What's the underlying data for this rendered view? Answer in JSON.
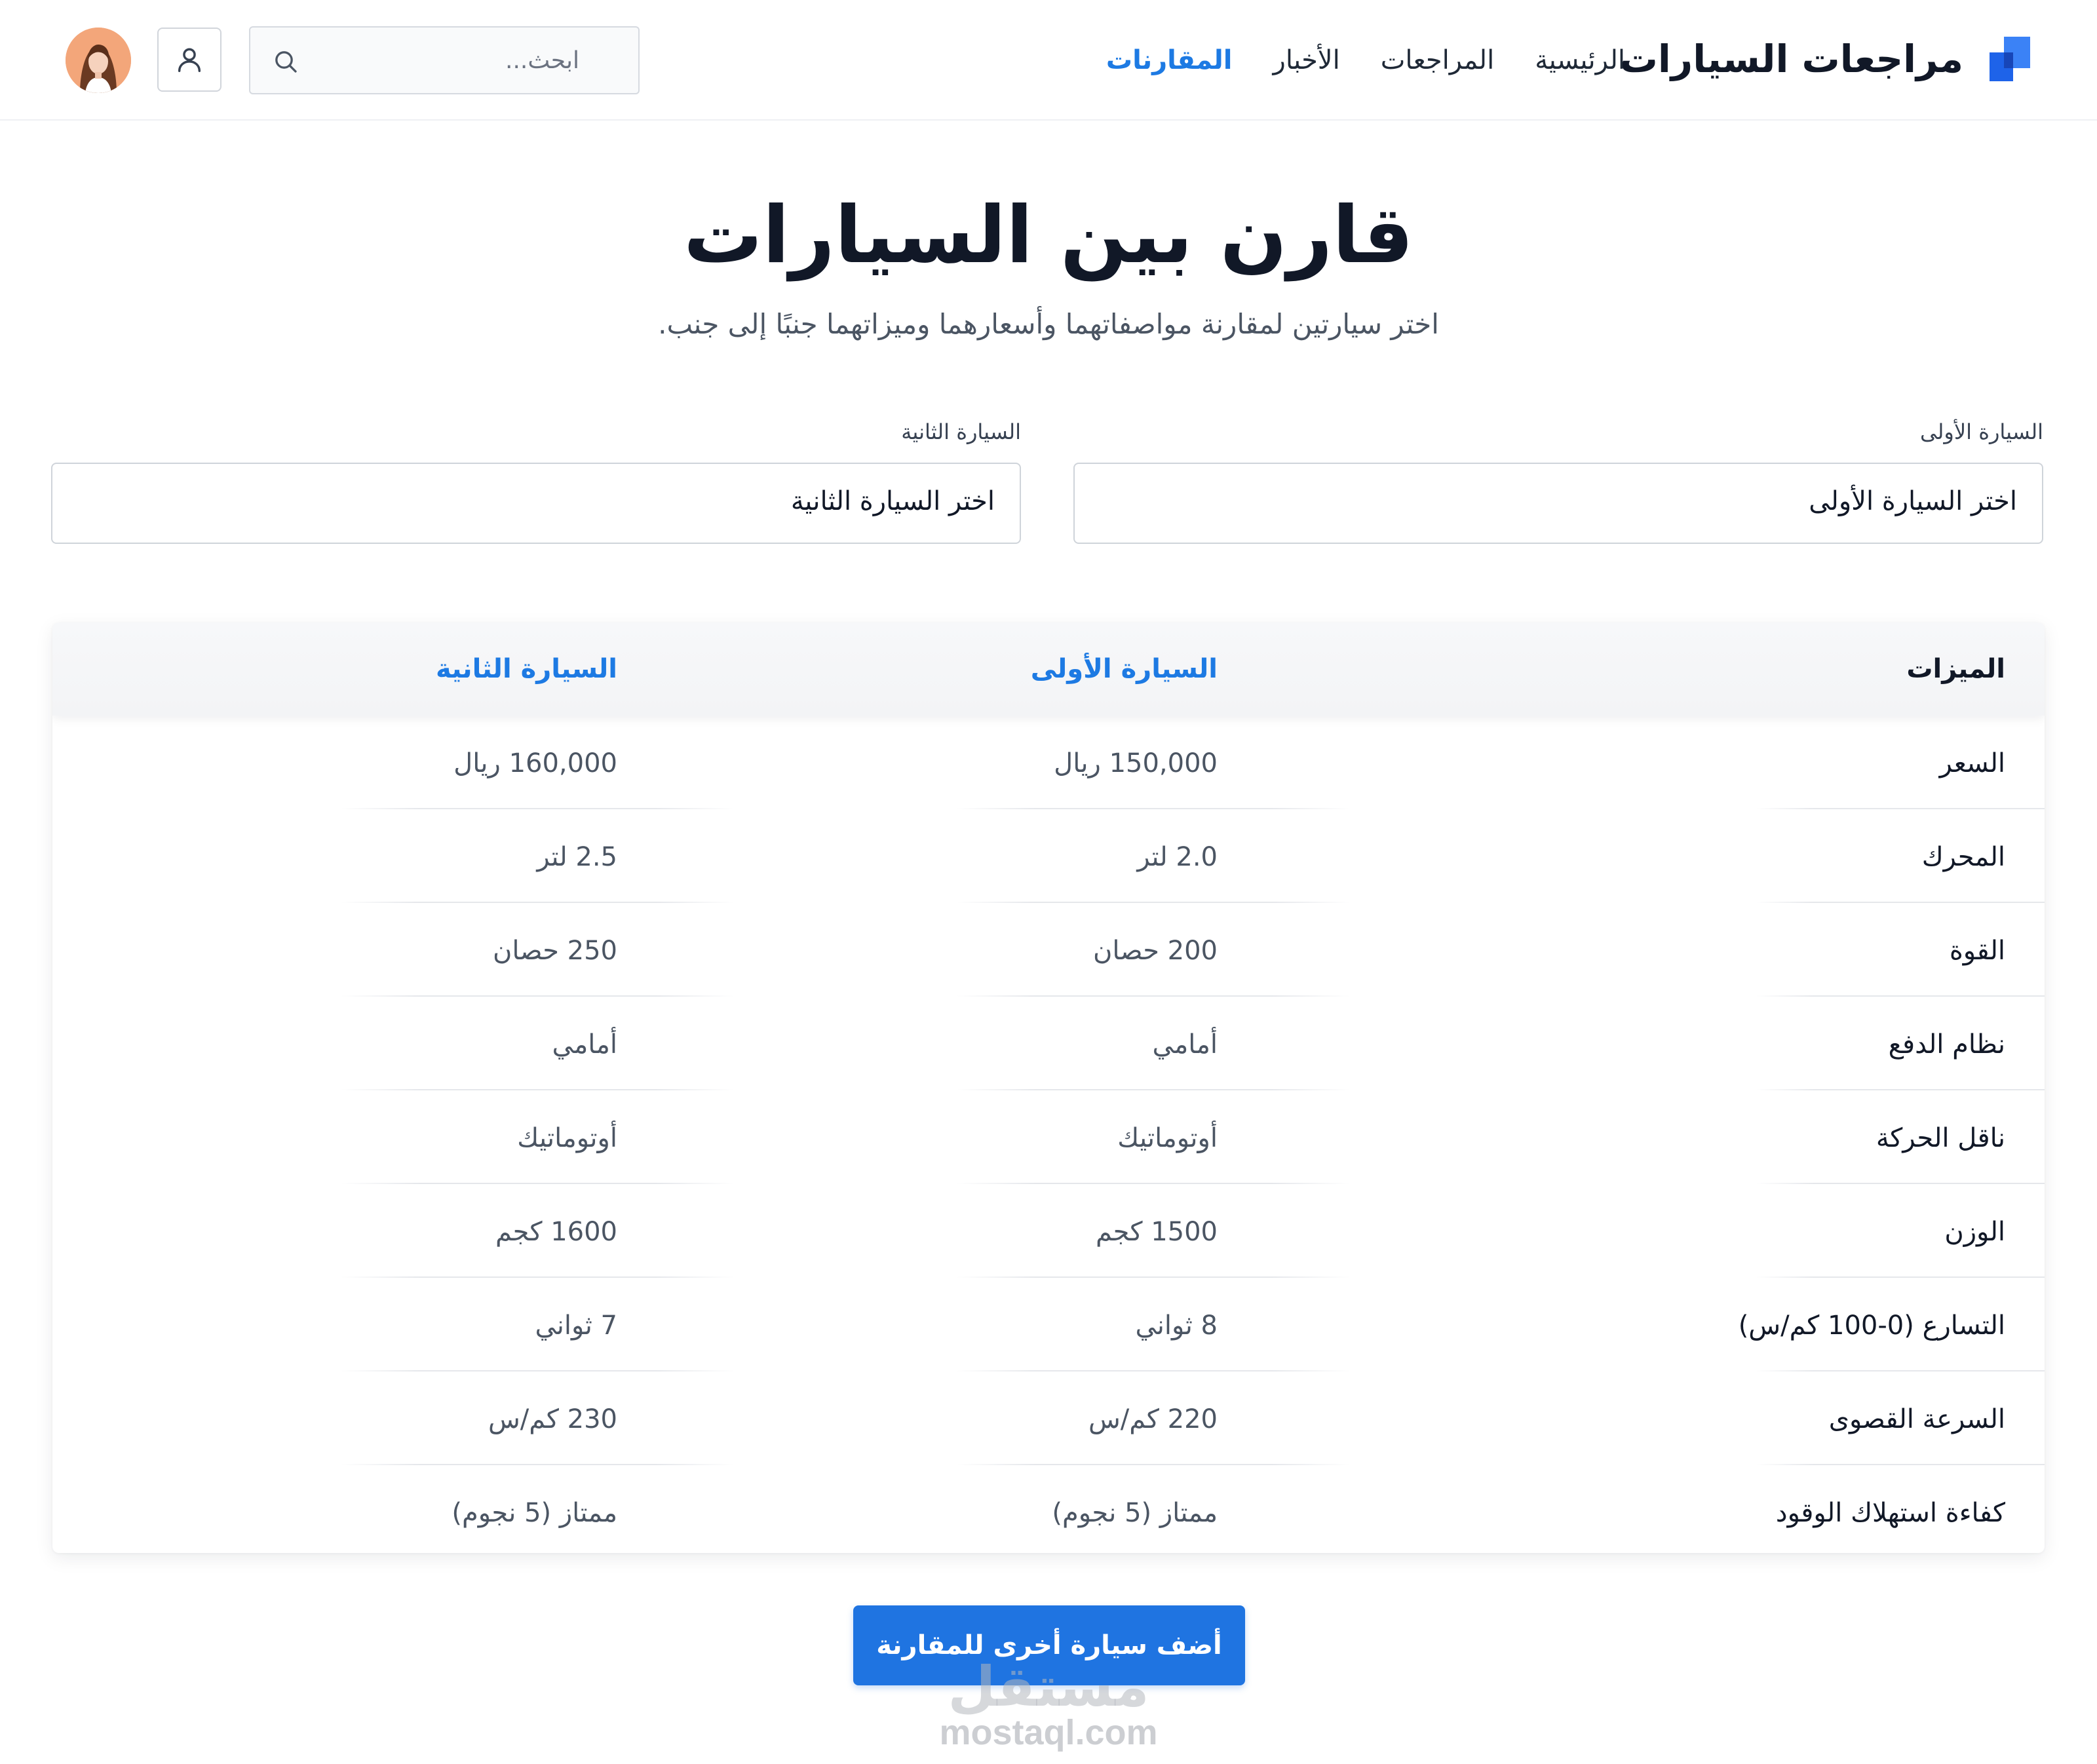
{
  "header": {
    "brand_title": "مراجعات السيارات",
    "nav": [
      {
        "label": "الرئيسية",
        "active": false
      },
      {
        "label": "المراجعات",
        "active": false
      },
      {
        "label": "الأخبار",
        "active": false
      },
      {
        "label": "المقارنات",
        "active": true
      }
    ],
    "search_placeholder": "ابحث...",
    "icons": {
      "search": "search-icon",
      "user": "user-icon",
      "avatar": "avatar"
    }
  },
  "hero": {
    "title": "قارن بين السيارات",
    "subtitle": "اختر سيارتين لمقارنة مواصفاتهما وأسعارهما وميزاتهما جنبًا إلى جنب."
  },
  "selectors": {
    "first": {
      "label": "السيارة الأولى",
      "value": "اختر السيارة الأولى"
    },
    "second": {
      "label": "السيارة الثانية",
      "value": "اختر السيارة الثانية"
    }
  },
  "table": {
    "headers": {
      "feature": "الميزات",
      "car1": "السيارة الأولى",
      "car2": "السيارة الثانية"
    },
    "rows": [
      {
        "feature": "السعر",
        "car1": "150,000 ريال",
        "car2": "160,000 ريال"
      },
      {
        "feature": "المحرك",
        "car1": "2.0 لتر",
        "car2": "2.5 لتر"
      },
      {
        "feature": "القوة",
        "car1": "200 حصان",
        "car2": "250 حصان"
      },
      {
        "feature": "نظام الدفع",
        "car1": "أمامي",
        "car2": "أمامي"
      },
      {
        "feature": "ناقل الحركة",
        "car1": "أوتوماتيك",
        "car2": "أوتوماتيك"
      },
      {
        "feature": "الوزن",
        "car1": "1500 كجم",
        "car2": "1600 كجم"
      },
      {
        "feature": "التسارع (0-100 كم/س)",
        "car1": "8 ثواني",
        "car2": "7 ثواني"
      },
      {
        "feature": "السرعة القصوى",
        "car1": "220 كم/س",
        "car2": "230 كم/س"
      },
      {
        "feature": "كفاءة استهلاك الوقود",
        "car1": "ممتاز (5 نجوم)",
        "car2": "ممتاز (5 نجوم)"
      }
    ]
  },
  "cta_label": "أضف سيارة أخرى للمقارنة",
  "watermark": {
    "arabic": "مستقل",
    "latin": "mostaql.com"
  },
  "colors": {
    "accent": "#1d7ae3",
    "button": "#1f74e1",
    "text": "#111827",
    "muted": "#4b5563"
  }
}
